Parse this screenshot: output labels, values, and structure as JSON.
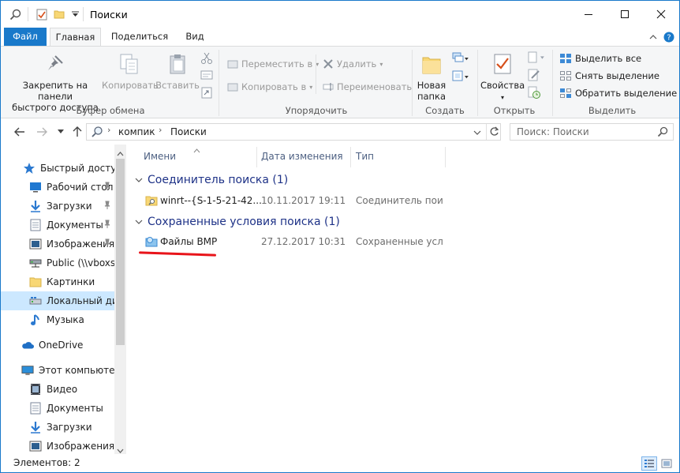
{
  "window": {
    "title": "Поиски",
    "controls": {
      "minimize": "minimize-icon",
      "maximize": "maximize-icon",
      "close": "close-icon"
    }
  },
  "ribbon_tabs": [
    "Файл",
    "Главная",
    "Поделиться",
    "Вид"
  ],
  "ribbon": {
    "clipboard": {
      "pin_label": "Закрепить на панели быстрого доступа",
      "pin_label_1": "Закрепить на панели",
      "pin_label_2": "быстрого доступа",
      "copy_label": "Копировать",
      "paste_label": "Вставить",
      "group_label": "Буфер обмена"
    },
    "organize": {
      "move_label": "Переместить в",
      "copy_to_label": "Копировать в",
      "delete_label": "Удалить",
      "rename_label": "Переименовать",
      "group_label": "Упорядочить"
    },
    "create": {
      "new_folder_1": "Новая",
      "new_folder_2": "папка",
      "group_label": "Создать"
    },
    "open": {
      "properties_label": "Свойства",
      "group_label": "Открыть"
    },
    "select": {
      "select_all": "Выделить все",
      "select_none": "Снять выделение",
      "invert": "Обратить выделение",
      "group_label": "Выделить"
    }
  },
  "address": {
    "segments": [
      "компик",
      "Поиски"
    ],
    "search_placeholder": "Поиск: Поиски"
  },
  "sidebar": {
    "items": [
      {
        "label": "Быстрый доступ",
        "icon": "star-icon"
      },
      {
        "label": "Рабочий стол",
        "icon": "desktop-icon",
        "pinned": true
      },
      {
        "label": "Загрузки",
        "icon": "download-icon",
        "pinned": true
      },
      {
        "label": "Документы",
        "icon": "documents-icon",
        "pinned": true
      },
      {
        "label": "Изображения",
        "icon": "pictures-icon",
        "pinned": true
      },
      {
        "label": "Public (\\\\vboxsrv",
        "icon": "network-drive-icon"
      },
      {
        "label": "Картинки",
        "icon": "folder-icon"
      },
      {
        "label": "Локальный диск",
        "icon": "drive-icon",
        "selected": true
      },
      {
        "label": "Музыка",
        "icon": "music-icon"
      },
      {
        "label": "OneDrive",
        "icon": "cloud-icon"
      },
      {
        "label": "Этот компьютер",
        "icon": "computer-icon"
      },
      {
        "label": "Видео",
        "icon": "video-icon"
      },
      {
        "label": "Документы",
        "icon": "documents-icon"
      },
      {
        "label": "Загрузки",
        "icon": "download-icon"
      },
      {
        "label": "Изображения",
        "icon": "pictures-icon"
      }
    ]
  },
  "content": {
    "columns": [
      "Имени",
      "Дата изменения",
      "Тип"
    ],
    "groups": [
      {
        "title": "Соединитель поиска (1)",
        "rows": [
          {
            "name": "winrt--{S-1-5-21-42...",
            "date": "10.11.2017 19:11",
            "type": "Соединитель пои",
            "icon": "search-connector-icon"
          }
        ]
      },
      {
        "title": "Сохраненные условия поиска (1)",
        "rows": [
          {
            "name": "Файлы BMP",
            "date": "27.12.2017 10:31",
            "type": "Сохраненные усл...",
            "icon": "saved-search-icon"
          }
        ]
      }
    ]
  },
  "status": {
    "text": "Элементов: 2"
  },
  "colors": {
    "accent": "#1979ca",
    "selection": "#cce8ff",
    "group_title": "#1e3287",
    "annotation": "#e8141a"
  }
}
